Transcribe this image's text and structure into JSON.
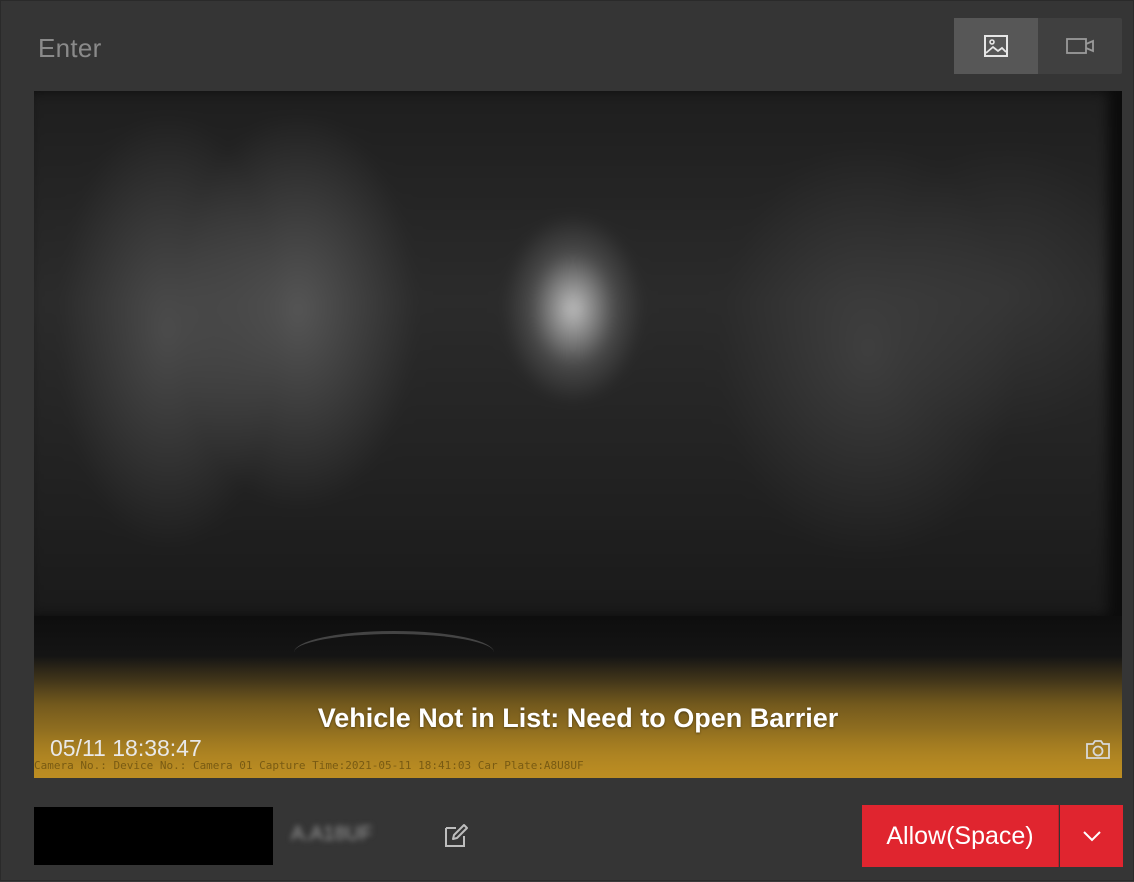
{
  "header": {
    "title": "Enter",
    "view_modes": [
      {
        "name": "picture",
        "icon": "image-icon",
        "active": true
      },
      {
        "name": "video",
        "icon": "video-camera-icon",
        "active": false
      }
    ]
  },
  "viewer": {
    "status_message": "Vehicle Not in List: Need to Open Barrier",
    "timestamp": "05/11 18:38:47",
    "overlay_text": "Camera No.: Device No.: Camera 01 Capture Time:2021-05-11 18:41:03 Car Plate:A8U8UF",
    "snapshot_icon": "camera-icon"
  },
  "footer": {
    "plate_number": "A.A18UF",
    "edit_icon": "edit-icon",
    "allow_label": "Allow(Space)",
    "dropdown_icon": "chevron-down-icon"
  },
  "colors": {
    "accent_red": "#e0252f",
    "background": "#353535",
    "status_amber": "#be8e22"
  }
}
